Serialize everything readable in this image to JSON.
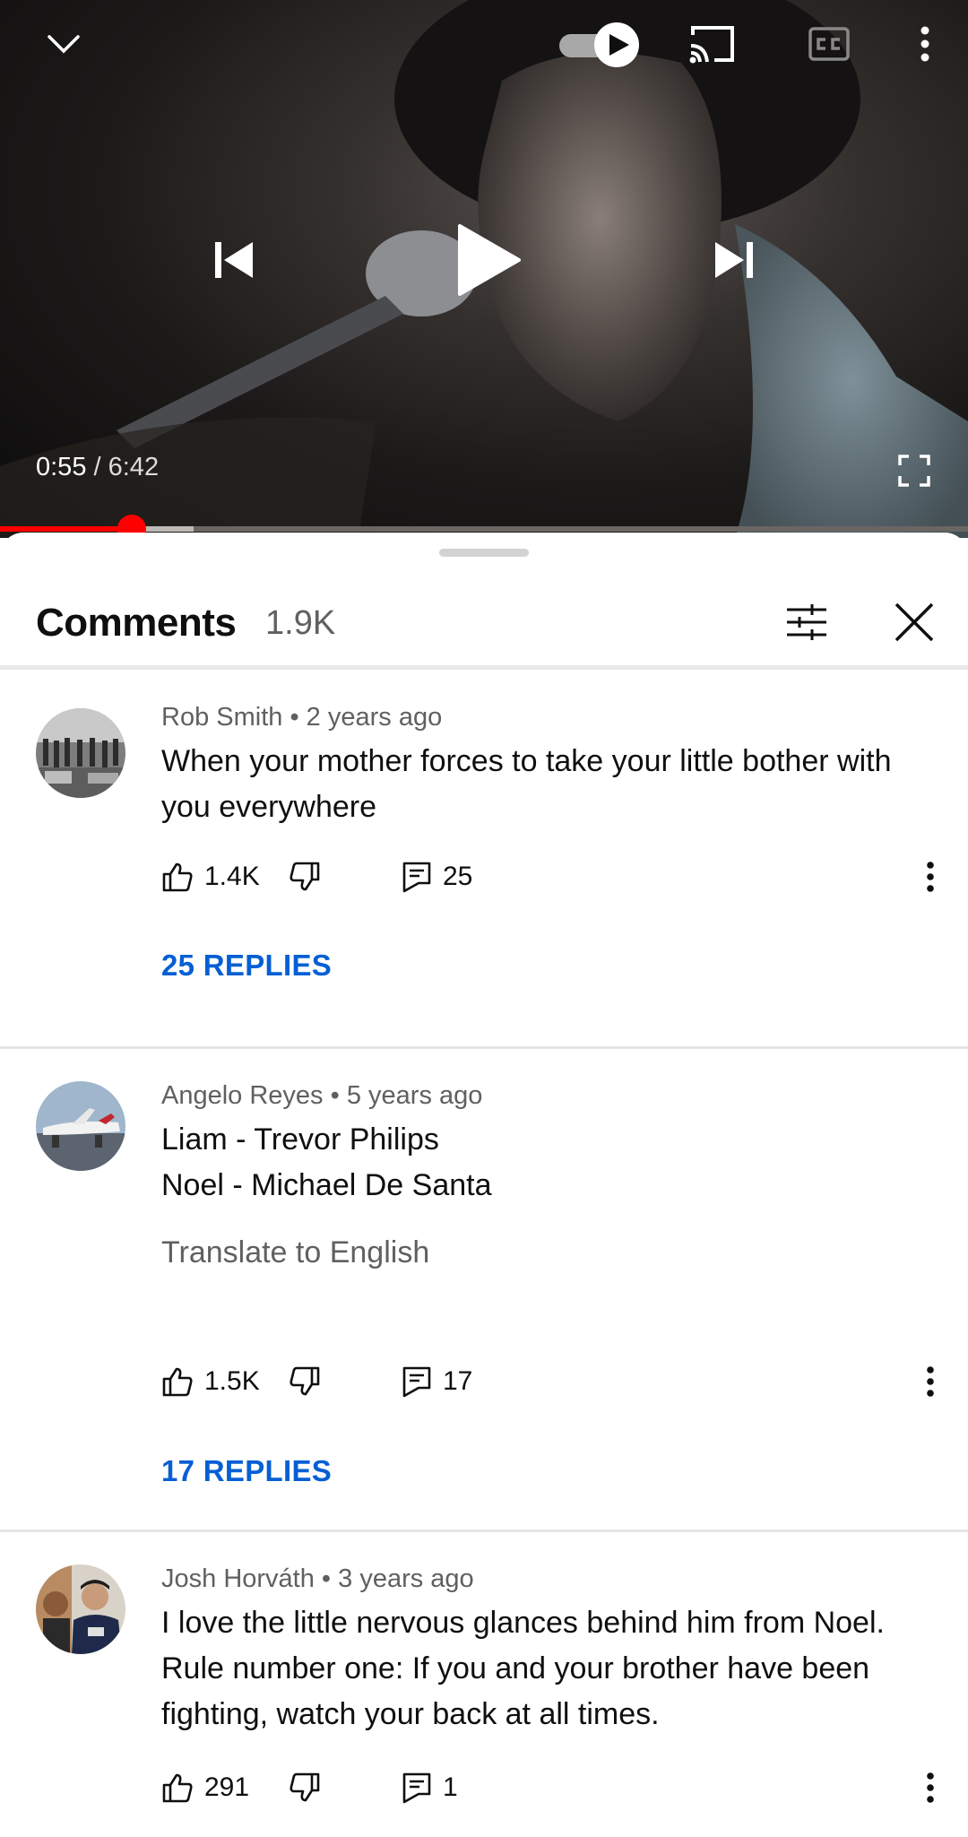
{
  "player": {
    "current_time": "0:55",
    "separator": " / ",
    "duration": "6:42",
    "progress_fraction": 0.136,
    "buffered_fraction": 0.2,
    "autoplay_on": true,
    "icons": [
      "chevron-down-icon",
      "autoplay-toggle",
      "cast-icon",
      "captions-icon",
      "more-vert-icon",
      "previous-icon",
      "play-icon",
      "next-icon",
      "fullscreen-icon"
    ]
  },
  "comments_panel": {
    "title": "Comments",
    "count": "1.9K"
  },
  "comments": [
    {
      "author": "Rob Smith",
      "age": "2 years ago",
      "lines": [
        "When your mother forces to take your little bother with",
        "you everywhere"
      ],
      "likes": "1.4K",
      "reply_count": "25",
      "replies_label": "25 REPLIES"
    },
    {
      "author": "Angelo Reyes",
      "age": "5 years ago",
      "lines": [
        "Liam - Trevor Philips",
        "Noel - Michael De Santa"
      ],
      "translate_label": "Translate to English",
      "likes": "1.5K",
      "reply_count": "17",
      "replies_label": "17 REPLIES"
    },
    {
      "author": "Josh Horváth",
      "age": "3 years ago",
      "lines": [
        "I love the little nervous glances behind him from Noel.",
        "Rule number one: If you and your brother have been",
        "fighting, watch your back at all times."
      ],
      "likes": "291",
      "reply_count": "1"
    }
  ],
  "colors": {
    "progress": "#ff0000",
    "link": "#065fd4",
    "secondary_text": "#606060"
  }
}
